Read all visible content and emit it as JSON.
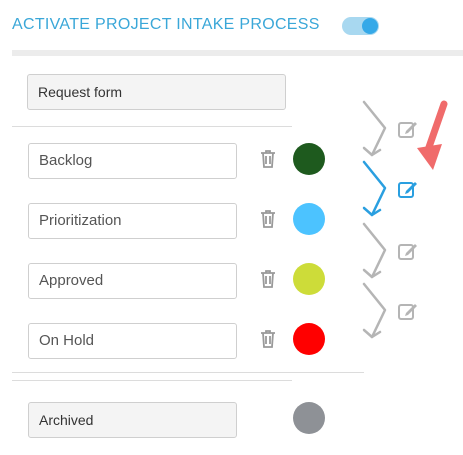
{
  "header": {
    "title": "ACTIVATE PROJECT INTAKE PROCESS",
    "toggle_on": true
  },
  "intake_field": {
    "value": "Request form"
  },
  "stages": [
    {
      "value": "Backlog",
      "color": "#1e5a1e",
      "icon": "trash-icon"
    },
    {
      "value": "Prioritization",
      "color": "#4cc3ff",
      "icon": "trash-icon"
    },
    {
      "value": "Approved",
      "color": "#cddc39",
      "icon": "trash-icon"
    },
    {
      "value": "On Hold",
      "color": "#ff0000",
      "icon": "trash-icon"
    }
  ],
  "archived": {
    "value": "Archived",
    "color": "#8e9196"
  },
  "colors": {
    "accent": "#3aa7d8",
    "connector_active": "#2a9fe0",
    "connector_inactive": "#b5b5b5",
    "arrow": "#f06b6b"
  }
}
